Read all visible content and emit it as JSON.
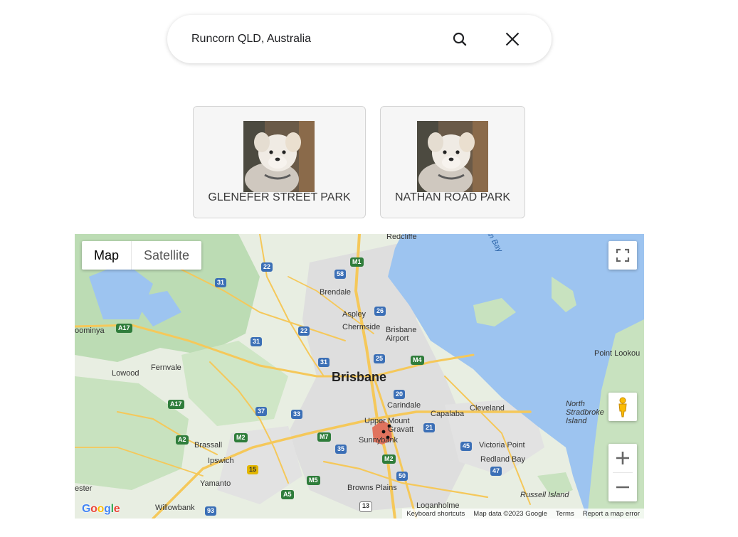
{
  "search": {
    "value": "Runcorn QLD, Australia",
    "search_icon": "search-icon",
    "close_icon": "close-icon"
  },
  "parks": [
    {
      "name": "GLENEFER STREET PARK",
      "photo": "dog-photo"
    },
    {
      "name": "NATHAN ROAD PARK",
      "photo": "dog-photo"
    }
  ],
  "map": {
    "map_type_options": [
      "Map",
      "Satellite"
    ],
    "selected_map_type": "Map",
    "labels": {
      "redcliffe": "Redcliffe",
      "bay": "on Bay",
      "brendale": "Brendale",
      "aspley": "Aspley",
      "chermside": "Chermside",
      "brisbane_airport": "Brisbane Airport",
      "woominya": "oominya",
      "brisbane": "Brisbane",
      "fernvale": "Fernvale",
      "lowood": "Lowood",
      "carindale": "Carindale",
      "capalaba": "Capalaba",
      "cleveland": "Cleveland",
      "upper_mount": "Upper Mount",
      "gravatt": "Gravatt",
      "sunnybank": "Sunnybank",
      "victoria_point": "Victoria Point",
      "redland_bay": "Redland Bay",
      "brassall": "Brassall",
      "ipswich": "Ipswich",
      "yamanto": "Yamanto",
      "browns_plains": "Browns Plains",
      "loganholme": "Loganholme",
      "russell_island": "Russell Island",
      "north_stradbroke_island": "North Stradbroke Island",
      "point_lookout": "Point Lookou",
      "willowbank": "Willowbank",
      "ester": "ester"
    },
    "road_shields": {
      "m1": "M1",
      "r22a": "22",
      "r58": "58",
      "r31a": "31",
      "r26": "26",
      "a17a": "A17",
      "r22b": "22",
      "r31b": "31",
      "r31c": "31",
      "r25": "25",
      "m4": "M4",
      "a17b": "A17",
      "r20": "20",
      "r37": "37",
      "r33": "33",
      "m7": "M7",
      "m2a": "M2",
      "a2": "A2",
      "r35": "35",
      "r21": "21",
      "r45": "45",
      "m2b": "M2",
      "r15": "15",
      "r47": "47",
      "r50": "50",
      "m5": "M5",
      "a5": "A5",
      "r93": "93",
      "r13": "13"
    },
    "footer": {
      "shortcuts": "Keyboard shortcuts",
      "map_data": "Map data ©2023 Google",
      "terms": "Terms",
      "report": "Report a map error"
    },
    "logo": "Google",
    "fullscreen_icon": "fullscreen-icon",
    "pegman_icon": "pegman-icon",
    "zoom_in_icon": "plus-icon",
    "zoom_out_icon": "minus-icon",
    "colors": {
      "water": "#9dc4f0",
      "land": "#e8eee2",
      "park": "#bcdcb4",
      "urban": "#dcdcdc",
      "road": "#f5c85a",
      "highlight": "#e0735e"
    }
  }
}
